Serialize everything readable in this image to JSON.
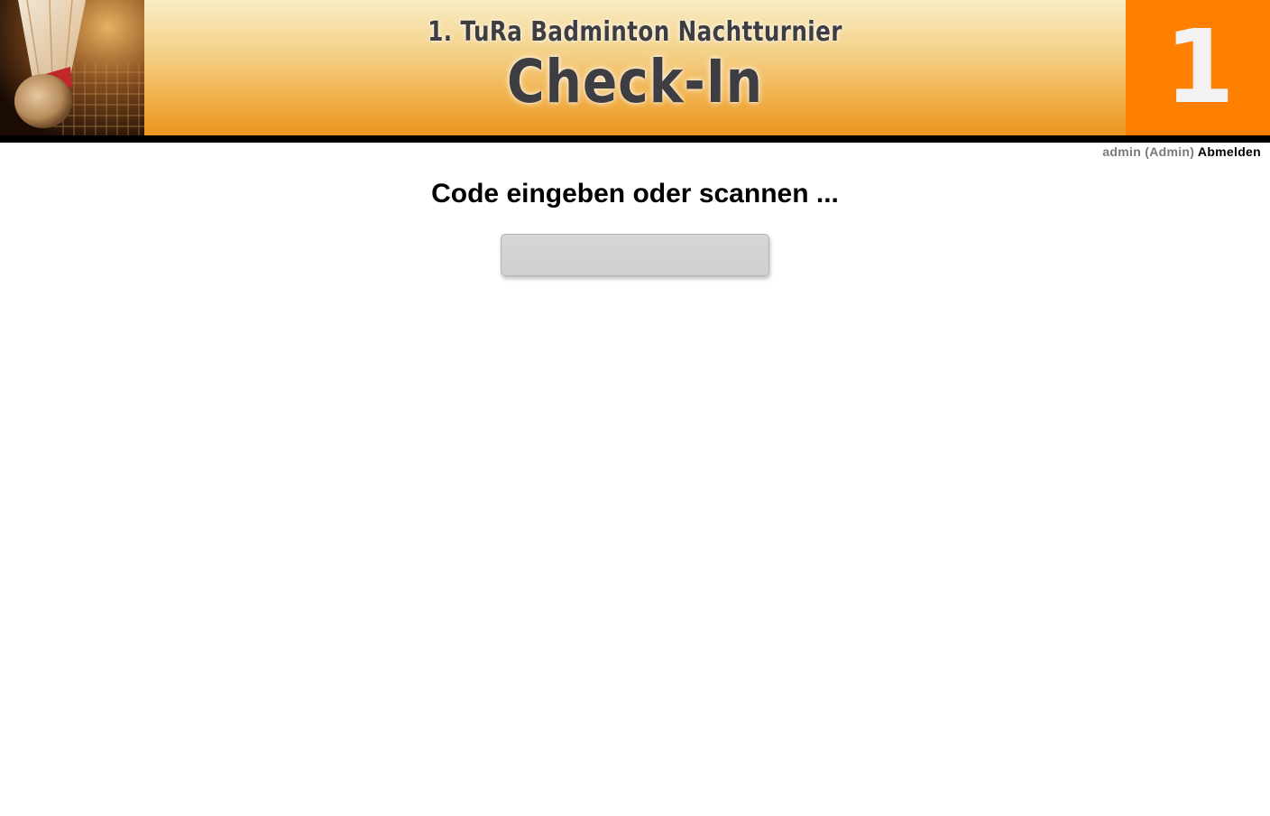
{
  "header": {
    "photo_icon": "badminton-shuttlecock-photo",
    "subtitle": "1. TuRa Badminton Nachtturnier",
    "title": "Check-In",
    "badge_number": "1",
    "colors": {
      "badge_background": "#ff8000",
      "gradient_top": "#f8ecc4",
      "gradient_bottom": "#eb9620",
      "title_text": "#3d3d42"
    }
  },
  "userbar": {
    "user": "admin (Admin)",
    "logout_label": "Abmelden"
  },
  "main": {
    "prompt": "Code eingeben oder scannen ...",
    "code_input": {
      "value": "",
      "placeholder": ""
    }
  }
}
